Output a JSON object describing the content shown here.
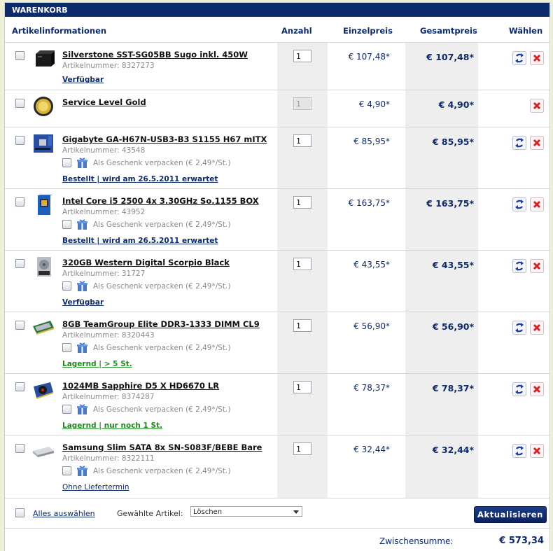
{
  "title": "WARENKORB",
  "columns": {
    "info": "Artikelinformationen",
    "qty": "Anzahl",
    "unit": "Einzelpreis",
    "total": "Gesamtpreis",
    "choose": "Wählen"
  },
  "gift_text": "Als Geschenk verpacken (€ 2,49*/St.)",
  "items": [
    {
      "name": "Silverstone SST-SG05BB Sugo inkl. 450W",
      "artnr": "Artikelnummer: 8327273",
      "status": "Verfügbar",
      "qty": "1",
      "unit": "€ 107,48*",
      "total": "€ 107,48*"
    },
    {
      "name": "Service Level Gold",
      "qty": "1",
      "unit": "€ 4,90*",
      "total": "€ 4,90*"
    },
    {
      "name": "Gigabyte GA-H67N-USB3-B3 S1155 H67 mITX",
      "artnr": "Artikelnummer: 43548",
      "status": "Bestellt | wird am 26.5.2011 erwartet",
      "qty": "1",
      "unit": "€ 85,95*",
      "total": "€ 85,95*"
    },
    {
      "name": "Intel Core i5 2500 4x 3.30GHz So.1155 BOX",
      "artnr": "Artikelnummer: 43952",
      "status": "Bestellt | wird am 26.5.2011 erwartet",
      "qty": "1",
      "unit": "€ 163,75*",
      "total": "€ 163,75*"
    },
    {
      "name": "320GB Western Digital Scorpio Black",
      "artnr": "Artikelnummer: 31727",
      "status": "Verfügbar",
      "qty": "1",
      "unit": "€ 43,55*",
      "total": "€ 43,55*"
    },
    {
      "name": "8GB TeamGroup Elite DDR3-1333 DIMM CL9",
      "artnr": "Artikelnummer: 8320443",
      "status": "Lagernd | > 5 St.",
      "qty": "1",
      "unit": "€ 56,90*",
      "total": "€ 56,90*"
    },
    {
      "name": "1024MB Sapphire D5 X HD6670 LR",
      "artnr": "Artikelnummer: 8374287",
      "status": "Lagernd | nur noch 1 St.",
      "qty": "1",
      "unit": "€ 78,37*",
      "total": "€ 78,37*"
    },
    {
      "name": "Samsung Slim SATA 8x SN-S083F/BEBE Bare",
      "artnr": "Artikelnummer: 8322111",
      "status": "Ohne Liefertermin",
      "qty": "1",
      "unit": "€ 32,44*",
      "total": "€ 32,44*"
    }
  ],
  "footer": {
    "select_all": "Alles auswählen",
    "selected_label": "Gewählte Artikel:",
    "selected_option": "Löschen",
    "update_button": "Aktualisieren"
  },
  "subtotal": {
    "label": "Zwischensumme:",
    "value": "€ 573,34"
  },
  "colors": {
    "brand": "#0d2a6b",
    "green": "#1f8a1f",
    "delete": "#d42020"
  }
}
